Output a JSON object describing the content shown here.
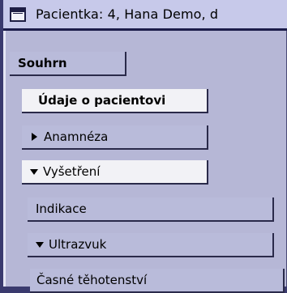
{
  "window": {
    "title": "Pacientka:  4, Hana Demo, d"
  },
  "sidebar": {
    "items": [
      {
        "label": "Souhrn"
      },
      {
        "label": "Údaje o pacientovi"
      },
      {
        "label": "Anamnéza"
      },
      {
        "label": "Vyšetření"
      },
      {
        "label": "Indikace"
      },
      {
        "label": "Ultrazvuk"
      },
      {
        "label": "Časné těhotenství"
      }
    ]
  }
}
